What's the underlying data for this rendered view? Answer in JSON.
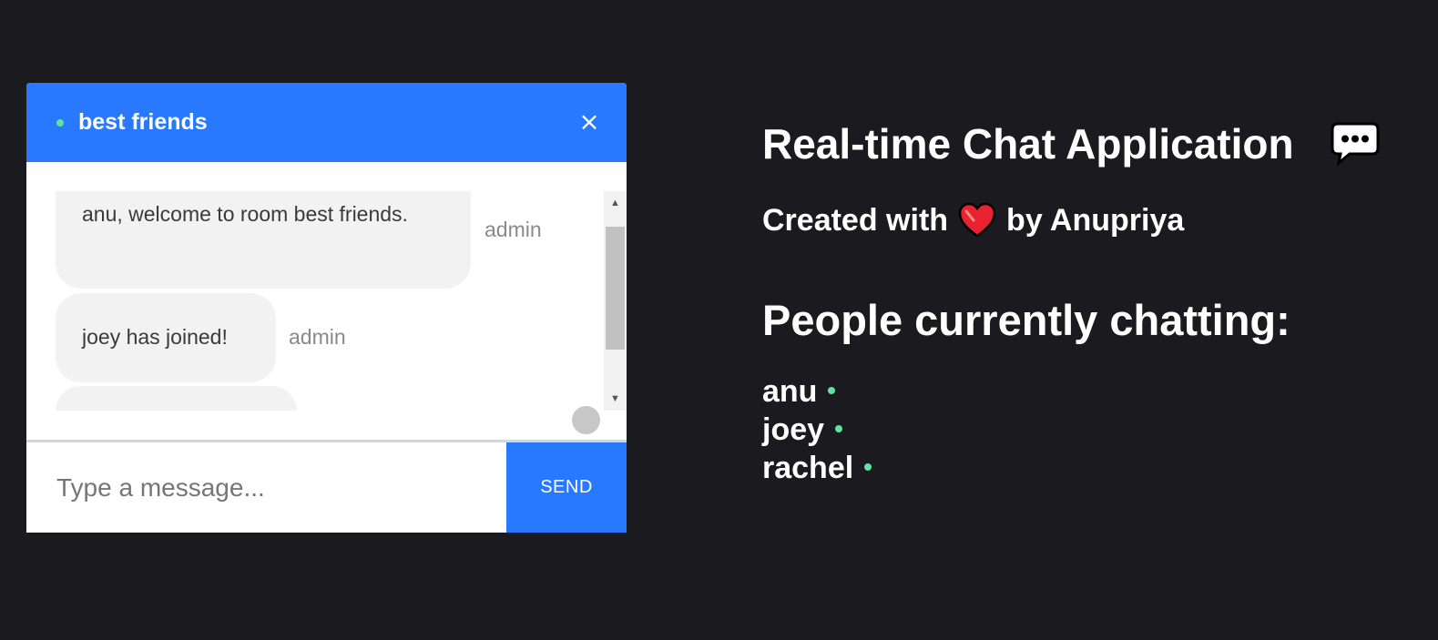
{
  "chat": {
    "room_name": "best friends",
    "close_symbol": "×",
    "messages": [
      {
        "text": "anu, welcome to room best friends.",
        "sender": "admin"
      },
      {
        "text": "joey has joined!",
        "sender": "admin"
      },
      {
        "text": "",
        "sender": ""
      }
    ],
    "input_placeholder": "Type a message...",
    "send_label": "SEND",
    "online_color": "#5ee3a1",
    "header_color": "#2979ff"
  },
  "info": {
    "title": "Real-time Chat Application",
    "title_icon": "speech-bubble-icon",
    "credit_prefix": "Created with",
    "credit_icon": "heart-icon",
    "credit_suffix": "by Anupriya",
    "people_heading": "People currently chatting:",
    "users": [
      "anu",
      "joey",
      "rachel"
    ]
  }
}
